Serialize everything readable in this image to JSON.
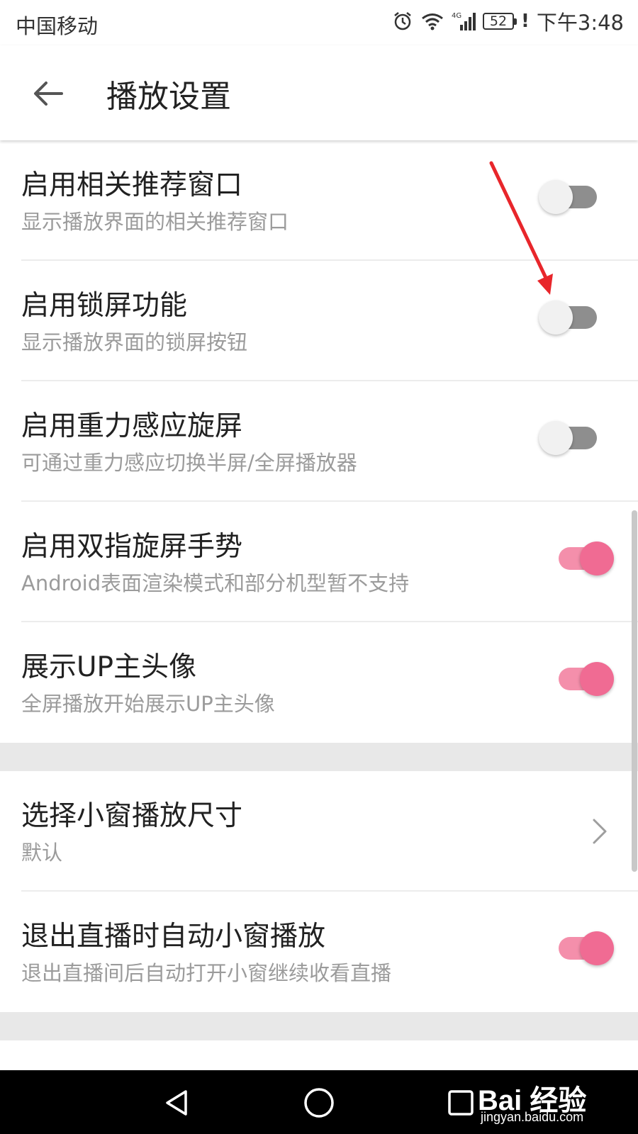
{
  "status_bar": {
    "carrier": "中国移动",
    "network": "4G",
    "battery": "52",
    "warning": "!",
    "time": "下午3:48"
  },
  "app_bar": {
    "title": "播放设置"
  },
  "settings": [
    {
      "title": "启用相关推荐窗口",
      "description": "显示播放界面的相关推荐窗口",
      "enabled": false
    },
    {
      "title": "启用锁屏功能",
      "description": "显示播放界面的锁屏按钮",
      "enabled": false
    },
    {
      "title": "启用重力感应旋屏",
      "description": "可通过重力感应切换半屏/全屏播放器",
      "enabled": false
    },
    {
      "title": "启用双指旋屏手势",
      "description": "Android表面渲染模式和部分机型暂不支持",
      "enabled": true
    },
    {
      "title": "展示UP主头像",
      "description": "全屏播放开始展示UP主头像",
      "enabled": true
    }
  ],
  "settings2": [
    {
      "title": "选择小窗播放尺寸",
      "value": "默认"
    },
    {
      "title": "退出直播时自动小窗播放",
      "description": "退出直播间后自动打开小窗继续收看直播",
      "enabled": true
    }
  ],
  "colors": {
    "accent": "#f06b93",
    "accent_track": "#f48fab",
    "switch_off_track": "#8e8e8e",
    "annotation_arrow": "#e8262b"
  },
  "watermark": {
    "brand": "Bai 经验",
    "site": "jingyan.baidu.com"
  }
}
